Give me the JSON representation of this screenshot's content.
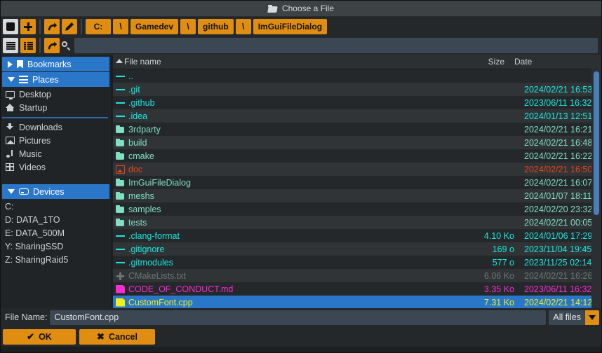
{
  "window": {
    "title": "Choose a File",
    "title_icon": "folder-open-icon"
  },
  "toolbar": {
    "drives_button_icon": "square-icon",
    "create_dir_button_icon": "plus-icon",
    "reset_button_icon": "curved-arrow-icon",
    "edit_path_button_icon": "pencil-icon",
    "breadcrumb": [
      {
        "label": "C:",
        "type": "path"
      },
      {
        "label": "\\",
        "type": "separator"
      },
      {
        "label": "Gamedev",
        "type": "path"
      },
      {
        "label": "\\",
        "type": "separator"
      },
      {
        "label": "github",
        "type": "path"
      },
      {
        "label": "\\",
        "type": "separator"
      },
      {
        "label": "ImGuiFileDialog",
        "type": "path"
      }
    ]
  },
  "toolbar2": {
    "list_view_icon": "list-icon",
    "table_view_icon": "table-icon",
    "reset_button_icon": "curved-arrow-icon",
    "search_icon": "search-icon",
    "search_value": "",
    "search_placeholder": ""
  },
  "sidebar": {
    "sections": [
      {
        "label": "Bookmarks",
        "icon": "bookmark-icon",
        "expanded": false,
        "arrow": "triangle-right"
      },
      {
        "label": "Places",
        "icon": "places-icon",
        "expanded": true,
        "arrow": "triangle-down"
      }
    ],
    "places_group_a": [
      {
        "label": "Desktop",
        "icon": "desktop-icon"
      },
      {
        "label": "Startup",
        "icon": "home-icon"
      }
    ],
    "places_group_b": [
      {
        "label": "Downloads",
        "icon": "download-icon"
      },
      {
        "label": "Pictures",
        "icon": "picture-icon"
      },
      {
        "label": "Music",
        "icon": "music-icon"
      },
      {
        "label": "Videos",
        "icon": "video-icon"
      }
    ],
    "devices_section": {
      "label": "Devices",
      "icon": "drive-icon",
      "expanded": true,
      "arrow": "triangle-down"
    },
    "devices": [
      {
        "label": "C:"
      },
      {
        "label": "D: DATA_1TO"
      },
      {
        "label": "E: DATA_500M"
      },
      {
        "label": "Y: SharingSSD"
      },
      {
        "label": "Z: SharingRaid5"
      }
    ]
  },
  "file_list": {
    "columns": {
      "name": "File name",
      "size": "Size",
      "date": "Date"
    },
    "sort_column": "name",
    "sort_direction": "ascending",
    "sort_icon": "chevron-up-icon",
    "rows": [
      {
        "name": "..",
        "size": "",
        "date": "",
        "icon": "dash-icon",
        "kind": "hidden-dir",
        "selected": false
      },
      {
        "name": ".git",
        "size": "",
        "date": "2024/02/21 16:53",
        "icon": "dash-icon",
        "kind": "hidden-dir",
        "selected": false
      },
      {
        "name": ".github",
        "size": "",
        "date": "2023/06/11 16:32",
        "icon": "dash-icon",
        "kind": "hidden-dir",
        "selected": false
      },
      {
        "name": ".idea",
        "size": "",
        "date": "2024/01/13 12:51",
        "icon": "dash-icon",
        "kind": "hidden-dir",
        "selected": false
      },
      {
        "name": "3rdparty",
        "size": "",
        "date": "2024/02/21 16:21",
        "icon": "folder-icon",
        "kind": "dir",
        "selected": false
      },
      {
        "name": "build",
        "size": "",
        "date": "2024/02/21 16:48",
        "icon": "folder-icon",
        "kind": "dir",
        "selected": false
      },
      {
        "name": "cmake",
        "size": "",
        "date": "2024/02/21 16:22",
        "icon": "folder-icon",
        "kind": "dir",
        "selected": false
      },
      {
        "name": "doc",
        "size": "",
        "date": "2024/02/21 16:50",
        "icon": "image-icon",
        "kind": "link",
        "selected": false
      },
      {
        "name": "ImGuiFileDialog",
        "size": "",
        "date": "2024/02/21 16:07",
        "icon": "folder-icon",
        "kind": "dir",
        "selected": false
      },
      {
        "name": "meshs",
        "size": "",
        "date": "2024/01/07 18:11",
        "icon": "folder-icon",
        "kind": "dir",
        "selected": false
      },
      {
        "name": "samples",
        "size": "",
        "date": "2024/02/20 23:32",
        "icon": "folder-icon",
        "kind": "dir",
        "selected": false
      },
      {
        "name": "tests",
        "size": "",
        "date": "2024/02/21 00:05",
        "icon": "folder-icon",
        "kind": "dir",
        "selected": false
      },
      {
        "name": ".clang-format",
        "size": "4.10 Ko",
        "date": "2024/01/06 17:29",
        "icon": "dash-icon",
        "kind": "hidden-file",
        "selected": false
      },
      {
        "name": ".gitignore",
        "size": "169 o",
        "date": "2023/11/04 19:45",
        "icon": "dash-icon",
        "kind": "hidden-file",
        "selected": false
      },
      {
        "name": ".gitmodules",
        "size": "577 o",
        "date": "2023/11/25 02:14",
        "icon": "dash-icon",
        "kind": "hidden-file",
        "selected": false
      },
      {
        "name": "CMakeLists.txt",
        "size": "6.06 Ko",
        "date": "2024/02/21 16:26",
        "icon": "plus-icon",
        "kind": "cmake",
        "selected": false
      },
      {
        "name": "CODE_OF_CONDUCT.md",
        "size": "3.35 Ko",
        "date": "2023/06/11 16:32",
        "icon": "file-icon",
        "kind": "markdown",
        "selected": false
      },
      {
        "name": "CustomFont.cpp",
        "size": "7.31 Ko",
        "date": "2024/02/21 14:12",
        "icon": "file-icon",
        "kind": "cpp",
        "selected": true
      }
    ],
    "scrollbar": {
      "orientation": "vertical",
      "thumb_position_percent": 0,
      "thumb_size_percent": 60
    }
  },
  "footer": {
    "file_name_label": "File Name:",
    "file_name_value": "CustomFont.cpp",
    "filter_value": "All files",
    "filter_arrow_icon": "chevron-down-icon",
    "ok_label": "OK",
    "ok_icon": "check-icon",
    "cancel_label": "Cancel",
    "cancel_icon": "cross-icon"
  },
  "colors": {
    "accent_orange": "#e08e12",
    "selection_blue": "#2a77c9",
    "hidden_cyan": "#1ae8e0",
    "dir_green": "#7fe0c0",
    "link_red": "#e8441a",
    "dim_grey": "#6e7476",
    "markdown_magenta": "#ff2ad4",
    "cpp_yellow": "#f2f20f",
    "window_bg": "#25282b"
  }
}
